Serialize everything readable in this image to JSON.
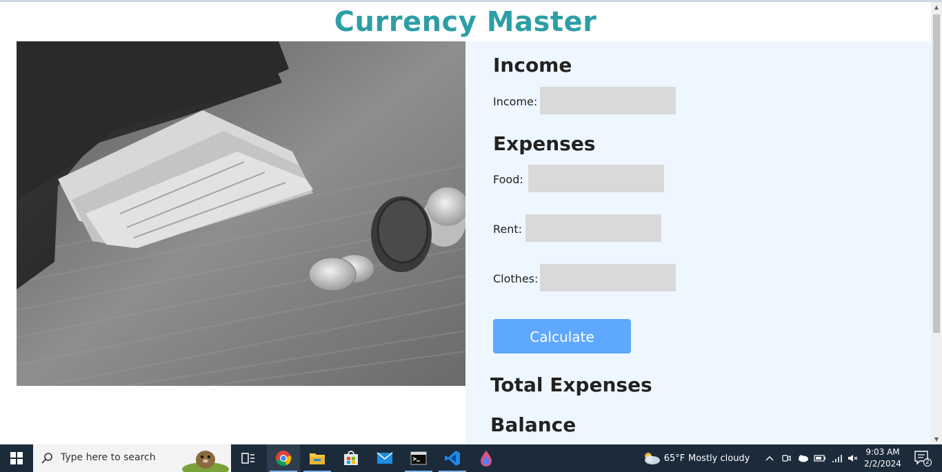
{
  "app": {
    "title": "Currency Master"
  },
  "photo": {
    "alt": "wallet with cash and coins"
  },
  "income": {
    "heading": "Income",
    "label": "Income:",
    "value": ""
  },
  "expenses": {
    "heading": "Expenses",
    "food_label": "Food:",
    "food_value": "",
    "rent_label": "Rent:",
    "rent_value": "",
    "clothes_label": "Clothes:",
    "clothes_value": ""
  },
  "calculate_label": "Calculate",
  "results": {
    "total_expenses_heading": "Total Expenses",
    "balance_heading": "Balance"
  },
  "colors": {
    "title": "#2e9ea6",
    "panel_bg": "#eef7ff",
    "button": "#5ea8ff",
    "field": "#d9d9d9",
    "taskbar": "#1b2b3a"
  },
  "taskbar": {
    "search_placeholder": "Type here to search",
    "pinned": [
      "task-view-icon",
      "chrome-icon",
      "file-explorer-icon",
      "store-icon",
      "mail-icon",
      "terminal-icon",
      "vscode-icon",
      "paint-drop-icon"
    ],
    "weather_temp": "65°F",
    "weather_text": "Mostly cloudy",
    "time": "9:03 AM",
    "date": "2/2/2024",
    "notification_count": "2"
  }
}
